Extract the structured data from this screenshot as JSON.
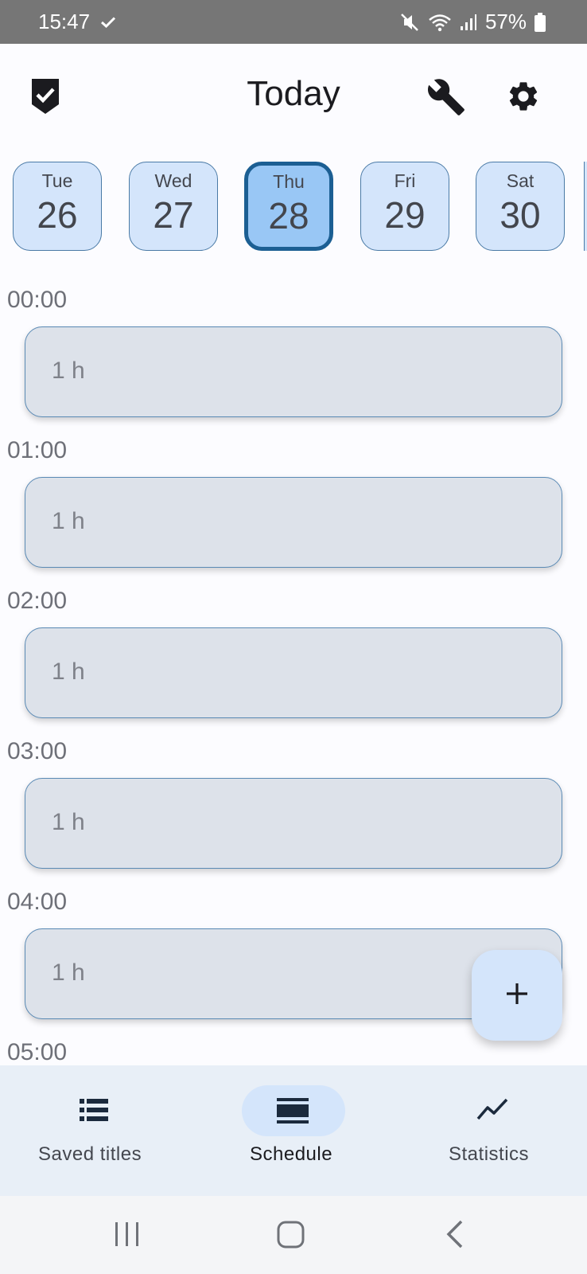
{
  "status_bar": {
    "time": "15:47",
    "battery": "57%",
    "icons": [
      "check-icon",
      "mute-icon",
      "wifi-icon",
      "signal-icon",
      "battery-icon"
    ]
  },
  "app_bar": {
    "title": "Today",
    "icons": [
      "app-logo-icon",
      "wrench-icon",
      "gear-icon"
    ]
  },
  "days": [
    {
      "name": "Tue",
      "num": "26",
      "selected": false
    },
    {
      "name": "Wed",
      "num": "27",
      "selected": false
    },
    {
      "name": "Thu",
      "num": "28",
      "selected": true
    },
    {
      "name": "Fri",
      "num": "29",
      "selected": false
    },
    {
      "name": "Sat",
      "num": "30",
      "selected": false
    }
  ],
  "timeline": [
    {
      "hour": "00:00",
      "duration": "1 h"
    },
    {
      "hour": "01:00",
      "duration": "1 h"
    },
    {
      "hour": "02:00",
      "duration": "1 h"
    },
    {
      "hour": "03:00",
      "duration": "1 h"
    },
    {
      "hour": "04:00",
      "duration": "1 h"
    },
    {
      "hour": "05:00",
      "duration": ""
    }
  ],
  "fab": {
    "icon": "plus-icon"
  },
  "bottom_nav": [
    {
      "label": "Saved titles",
      "icon": "list-icon",
      "active": false
    },
    {
      "label": "Schedule",
      "icon": "schedule-icon",
      "active": true
    },
    {
      "label": "Statistics",
      "icon": "chart-icon",
      "active": false
    }
  ],
  "system_nav": [
    "recents-icon",
    "home-icon",
    "back-icon"
  ],
  "colors": {
    "status_bar": "#767676",
    "day_card": "#d4e5fb",
    "day_selected": "#99c7f5",
    "day_selected_border": "#1c5f93",
    "slot": "#dde2ea",
    "bottom_nav": "#e8eff7"
  }
}
